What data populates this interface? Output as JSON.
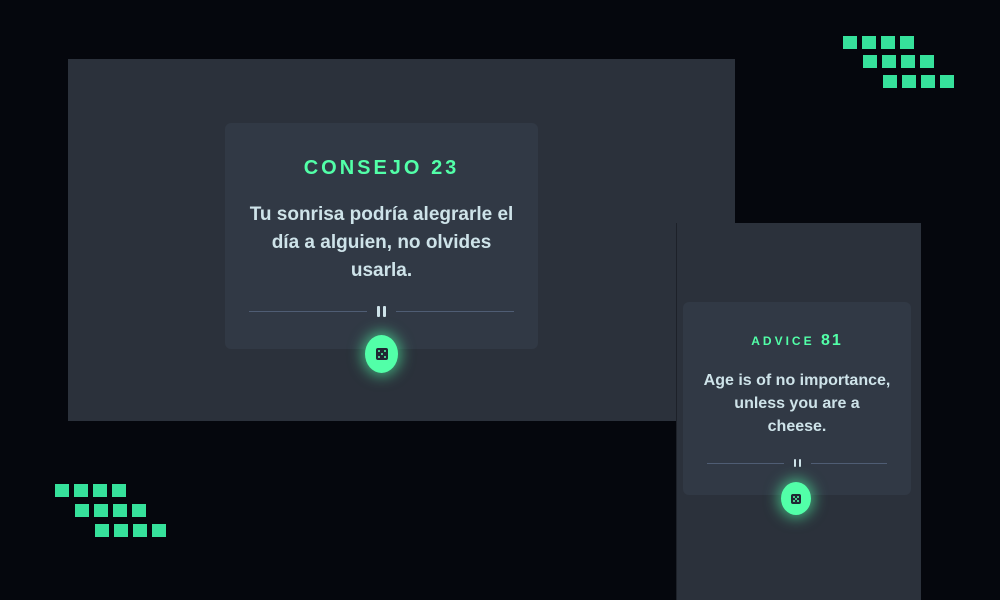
{
  "desktop_card": {
    "label_word": "CONSEJO",
    "label_number": "23",
    "quote": "Tu sonrisa podría alegrarle el día a alguien, no olvides usarla.",
    "button_icon": "dice-icon",
    "divider_icon": "pause-icon"
  },
  "mobile_card": {
    "label_word": "ADVICE",
    "label_number": "81",
    "quote": "Age is of no importance, unless you are a cheese.",
    "button_icon": "dice-icon",
    "divider_icon": "pause-icon"
  },
  "colors": {
    "page_background": "#05070d",
    "panel_background": "#2b313b",
    "card_background": "#313945",
    "accent_green": "#52ffa8",
    "quote_text": "#cee3e9",
    "divider": "#4f5d74"
  }
}
